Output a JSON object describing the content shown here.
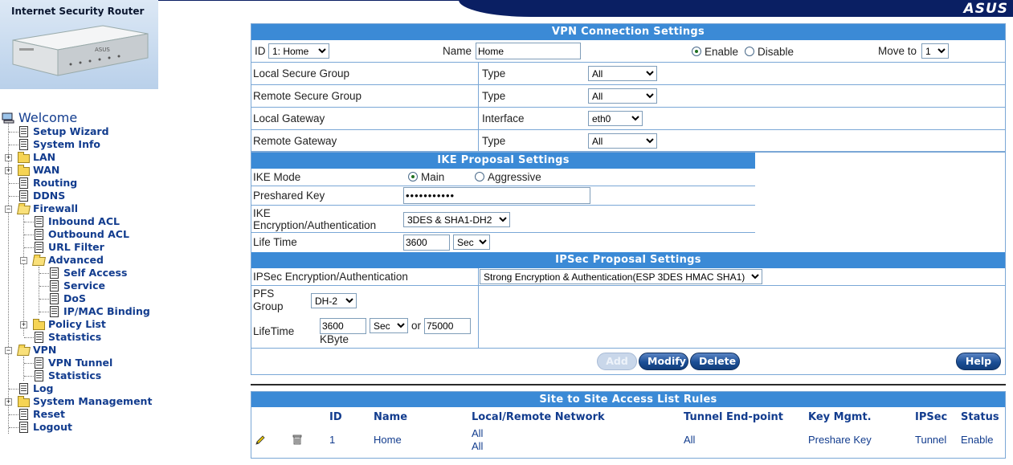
{
  "header": {
    "product_title": "Internet Security Router",
    "brand": "ASUS",
    "router_brand": "ASUS"
  },
  "sidebar": {
    "welcome": "Welcome",
    "items": {
      "setup_wizard": "Setup Wizard",
      "system_info": "System Info",
      "lan": "LAN",
      "wan": "WAN",
      "routing": "Routing",
      "ddns": "DDNS",
      "firewall": "Firewall",
      "inbound_acl": "Inbound ACL",
      "outbound_acl": "Outbound ACL",
      "url_filter": "URL Filter",
      "advanced": "Advanced",
      "self_access": "Self Access",
      "service": "Service",
      "dos": "DoS",
      "ip_mac_binding": "IP/MAC Binding",
      "policy_list": "Policy List",
      "fw_statistics": "Statistics",
      "vpn": "VPN",
      "vpn_tunnel": "VPN Tunnel",
      "vpn_statistics": "Statistics",
      "log": "Log",
      "system_management": "System Management",
      "reset": "Reset",
      "logout": "Logout"
    }
  },
  "vpn_connection": {
    "title": "VPN Connection Settings",
    "id_label": "ID",
    "id_value": "1: Home",
    "name_label": "Name",
    "name_value": "Home",
    "enable_label": "Enable",
    "disable_label": "Disable",
    "move_to_label": "Move to",
    "move_to_value": "1",
    "local_secure_group": "Local Secure Group",
    "local_secure_type_label": "Type",
    "local_secure_type_value": "All",
    "remote_secure_group": "Remote Secure Group",
    "remote_secure_type_label": "Type",
    "remote_secure_type_value": "All",
    "local_gateway": "Local Gateway",
    "local_gateway_iface_label": "Interface",
    "local_gateway_iface_value": "eth0",
    "remote_gateway": "Remote Gateway",
    "remote_gateway_type_label": "Type",
    "remote_gateway_type_value": "All"
  },
  "ike": {
    "title": "IKE Proposal Settings",
    "mode_label": "IKE Mode",
    "mode_main": "Main",
    "mode_aggressive": "Aggressive",
    "psk_label": "Preshared Key",
    "psk_value": "•••••••••••",
    "enc_label_line1": "IKE",
    "enc_label_line2": "Encryption/Authentication",
    "enc_value": "3DES & SHA1-DH2",
    "lifetime_label": "Life Time",
    "lifetime_value": "3600",
    "lifetime_unit": "Sec"
  },
  "ipsec": {
    "title": "IPSec Proposal Settings",
    "enc_label": "IPSec Encryption/Authentication",
    "enc_value": "Strong Encryption & Authentication(ESP 3DES HMAC SHA1)",
    "pfs_label_line1": "PFS",
    "pfs_label_line2": "Group",
    "pfs_value": "DH-2",
    "lifetime_label": "LifeTime",
    "lifetime_value": "3600",
    "lifetime_unit": "Sec",
    "or_label": "or",
    "kbyte_value": "75000",
    "kbyte_label": "KByte"
  },
  "buttons": {
    "add": "Add",
    "modify": "Modify",
    "delete": "Delete",
    "help": "Help"
  },
  "rules_table": {
    "title": "Site to Site Access List Rules",
    "columns": [
      "ID",
      "Name",
      "Local/Remote Network",
      "Tunnel End-point",
      "Key Mgmt.",
      "IPSec",
      "Status"
    ],
    "rows": [
      {
        "id": "1",
        "name": "Home",
        "local_network": "All",
        "remote_network": "All",
        "tunnel_endpoint": "All",
        "key_mgmt": "Preshare Key",
        "ipsec": "Tunnel",
        "status": "Enable"
      }
    ]
  }
}
